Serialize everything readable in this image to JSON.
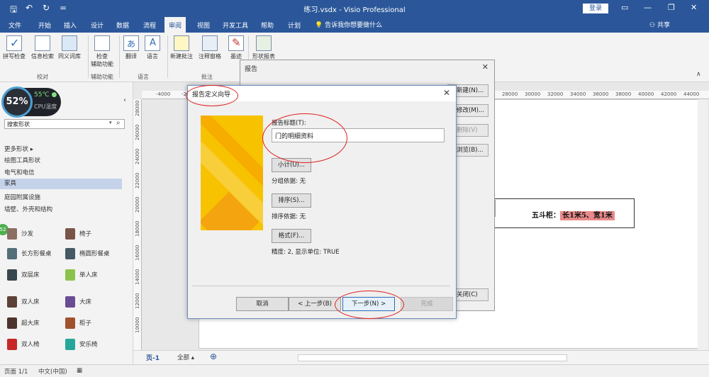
{
  "titlebar": {
    "app_title": "练习.vsdx - Visio Professional",
    "login": "登录",
    "qat": [
      "🖫",
      "↶",
      "↻",
      "="
    ],
    "window_controls": [
      "▭",
      "—",
      "❐",
      "✕"
    ]
  },
  "tabs": {
    "items": [
      "文件",
      "开始",
      "插入",
      "设计",
      "数据",
      "流程",
      "审阅",
      "视图",
      "开发工具",
      "帮助",
      "计划"
    ],
    "active": "审阅",
    "tell_me": "告诉我你想要做什么",
    "share": "共享"
  },
  "ribbon": {
    "buttons": {
      "spell": "拼写检查",
      "info": "信息检索",
      "thesaurus": "同义词库",
      "check": "检查",
      "accessibility": "辅助功能",
      "translate": "翻译",
      "language": "语言",
      "new_comment": "新建批注",
      "comment_pane": "注释窗格",
      "ink": "墨迹",
      "shape_report": "形状报表"
    },
    "groups": {
      "proofing": "校对",
      "accessibility": "辅助功能",
      "language": "语言",
      "comments": "批注"
    }
  },
  "left_panel": {
    "cpu": {
      "percent": "52%",
      "temp": "55℃",
      "label": "CPU温度"
    },
    "search_placeholder": "搜索形状",
    "categories": [
      "更多形状",
      "绘图工具形状",
      "电气和电信",
      "家具",
      "庭园附属设施",
      "墙壁、外壳和结构"
    ],
    "selected_category": "家具",
    "green_badge": "52",
    "shapes": [
      {
        "label": "沙发",
        "color": "#8d6e63"
      },
      {
        "label": "椅子",
        "color": "#795548"
      },
      {
        "label": "长方形餐桌",
        "color": "#546e7a"
      },
      {
        "label": "椭圆形餐桌",
        "color": "#455a64"
      },
      {
        "label": "双层床",
        "color": "#37474f"
      },
      {
        "label": "单人床",
        "color": "#8bc34a"
      },
      {
        "label": "双人床",
        "color": "#5d4037"
      },
      {
        "label": "大床",
        "color": "#6a4c93"
      },
      {
        "label": "超大床",
        "color": "#4e342e"
      },
      {
        "label": "柜子",
        "color": "#a0522d"
      },
      {
        "label": "双人椅",
        "color": "#c62828"
      },
      {
        "label": "安乐椅",
        "color": "#26a69a"
      }
    ]
  },
  "ruler": {
    "top": [
      "-4000",
      "-2000",
      "0",
      "28000",
      "30000",
      "32000",
      "34000",
      "36000",
      "38000",
      "40000",
      "42000",
      "44000"
    ],
    "left": [
      "28000",
      "26000",
      "24000",
      "22000",
      "20000",
      "18000",
      "16000",
      "14000",
      "12000",
      "10000"
    ]
  },
  "callout": {
    "prefix": "五斗柜：",
    "highlight": "长1米5、宽1米"
  },
  "report_dialog": {
    "title": "报告",
    "close": "✕",
    "buttons": [
      "新建(N)...",
      "修改(M)...",
      "删除(V)",
      "浏览(B)..."
    ],
    "close_button": "关闭(C)"
  },
  "wizard": {
    "title": "报告定义向导",
    "close": "✕",
    "report_title_label": "报告标题(T):",
    "report_title_value": "门的明细资料",
    "subtotal_button": "小计(U)...",
    "group_by": "分组依据: 无",
    "sort_button": "排序(S)...",
    "sort_by": "排序依据: 无",
    "format_button": "格式(F)...",
    "precision": "精度: 2, 显示单位: TRUE",
    "cancel": "取消",
    "back": "< 上一步(B)",
    "next": "下一步(N) >",
    "finish": "完成"
  },
  "pagebar": {
    "page_tab": "页-1",
    "all": "全部 ▴",
    "add": "⊕"
  },
  "statusbar": {
    "page": "页面 1/1",
    "language": "中文(中国)"
  }
}
